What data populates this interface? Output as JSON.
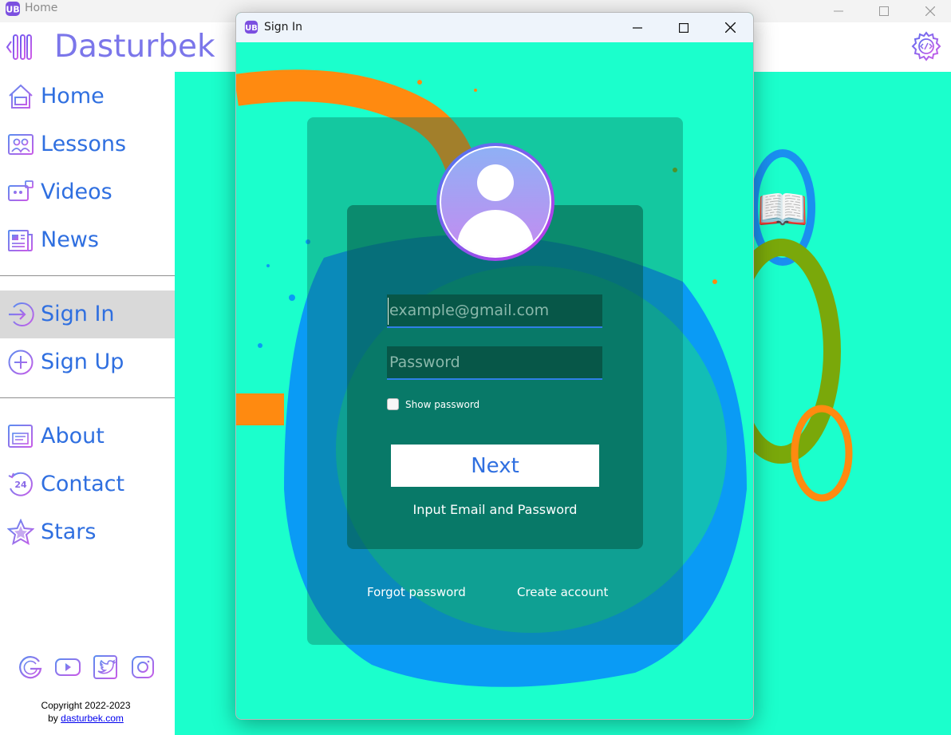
{
  "main_window": {
    "title": "Home"
  },
  "header": {
    "brand": "Dasturbek"
  },
  "sidebar": {
    "items": [
      {
        "label": "Home",
        "icon": "home-icon"
      },
      {
        "label": "Lessons",
        "icon": "lessons-icon"
      },
      {
        "label": "Videos",
        "icon": "videos-icon"
      },
      {
        "label": "News",
        "icon": "news-icon"
      },
      {
        "label": "Sign In",
        "icon": "sign-in-icon",
        "active": true
      },
      {
        "label": "Sign Up",
        "icon": "sign-up-icon"
      },
      {
        "label": "About",
        "icon": "about-icon"
      },
      {
        "label": "Contact",
        "icon": "contact-24-icon"
      },
      {
        "label": "Stars",
        "icon": "star-icon"
      }
    ],
    "socials": [
      "google-icon",
      "youtube-icon",
      "twitter-icon",
      "instagram-icon"
    ],
    "copyright_line": "Copyright 2022-2023",
    "by_prefix": "by",
    "by_link": "dasturbek.com"
  },
  "signin": {
    "title": "Sign In",
    "email_placeholder": "example@gmail.com",
    "password_placeholder": "Password",
    "show_password_label": "Show password",
    "next_label": "Next",
    "status_text": "Input Email and Password",
    "forgot_link": "Forgot password",
    "create_link": "Create account"
  },
  "colors": {
    "accent": "#2f6fe0",
    "brand": "#7b76ea",
    "background": "#1bffcc",
    "icon_purple": "#9b5cf0"
  }
}
